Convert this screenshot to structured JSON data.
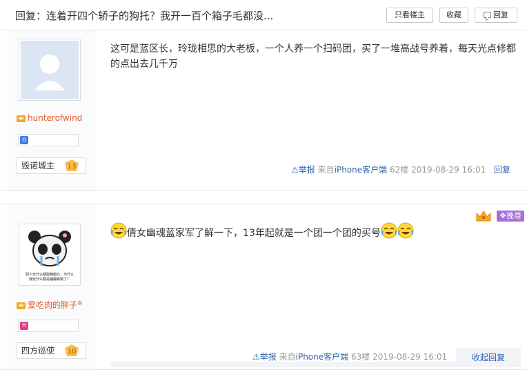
{
  "header": {
    "title": "回复：连着开四个轿子的狗托？我开一百个箱子毛都没...",
    "only_author": "只看楼主",
    "favorite": "收藏",
    "reply": "回复"
  },
  "posts": [
    {
      "user": {
        "name": "hunterofwind",
        "zodiac": "天秤",
        "rank": "毁诺城主",
        "level": "13",
        "zodiac_color": "#3b7ddd"
      },
      "content": "这可是蓝区长，玲珑相思的大老板，一个人养一个扫码团，买了一堆高战号养着，每天光点修都的点出去几千万",
      "report": "举报",
      "from": "来自",
      "device": "iPhone客户端",
      "floor": "62楼",
      "time": "2019-08-29 16:01",
      "reply": "回复"
    },
    {
      "user": {
        "name": "爱吃肉的胖子",
        "zodiac": "双鱼",
        "rank": "四方巡使",
        "level": "10",
        "zodiac_color": "#e63a8b",
        "avatar_caption": "别人玩什么都能精能匹，为什么我玩什么都是蹦蹦跳跳了？"
      },
      "content": "倩女幽魂蓝家军了解一下，13年起就是一个团一个团的买号",
      "report": "举报",
      "from": "来自",
      "device": "iPhone客户端",
      "floor": "63楼",
      "time": "2019-08-29 16:01",
      "collapse": "收起回复",
      "badge_tag": "挽尊"
    }
  ],
  "colors": {
    "username": "#e45c2b",
    "link": "#2d64b3",
    "muted": "#999999"
  },
  "icons": [
    "crown-icon",
    "zodiac-libra-icon",
    "zodiac-pisces-icon",
    "level-badge-icon",
    "warning-icon",
    "laugh-cry-emoji",
    "comment-icon"
  ]
}
